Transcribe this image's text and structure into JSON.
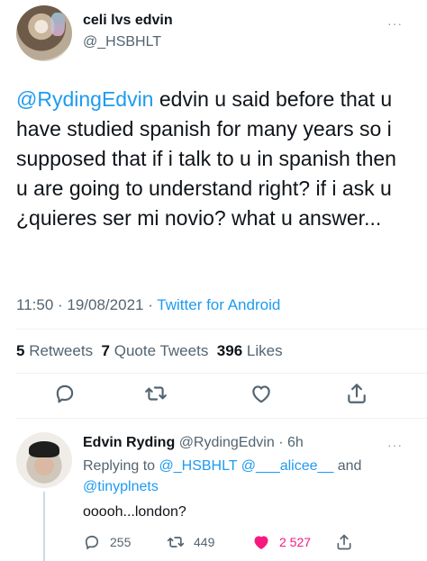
{
  "main_tweet": {
    "author_name": "celi lvs edvin",
    "author_handle": "@_HSBHLT",
    "mention": "@RydingEdvin",
    "text": " edvin u said before that u have studied spanish for many years so i supposed that if i talk to u in spanish then u are going to understand right? if i ask u ¿quieres ser mi novio? what u answer...",
    "time": "11:50",
    "date": "19/08/2021",
    "source": "Twitter for Android",
    "separator": " · ",
    "more_label": "···",
    "retweets_count": "5",
    "retweets_label": "Retweets",
    "quotes_count": "7",
    "quotes_label": "Quote Tweets",
    "likes_count": "396",
    "likes_label": "Likes"
  },
  "reply": {
    "author_name": "Edvin Ryding",
    "author_handle": "@RydingEdvin",
    "age": "6h",
    "more_label": "···",
    "replying_prefix": "Replying to ",
    "replying_to": [
      "@_HSBHLT",
      "@___alicee__",
      "@tinyplnets"
    ],
    "replying_and": "and",
    "text": "ooooh...london?",
    "reply_count": "255",
    "retweet_count": "449",
    "like_count": "2 527"
  },
  "icons": {
    "reply": "reply-icon",
    "retweet": "retweet-icon",
    "like": "heart-icon",
    "share": "share-icon",
    "more": "more-icon"
  },
  "colors": {
    "accent": "#1d9bf0",
    "secondary_text": "#536471",
    "like_active": "#f91880"
  }
}
